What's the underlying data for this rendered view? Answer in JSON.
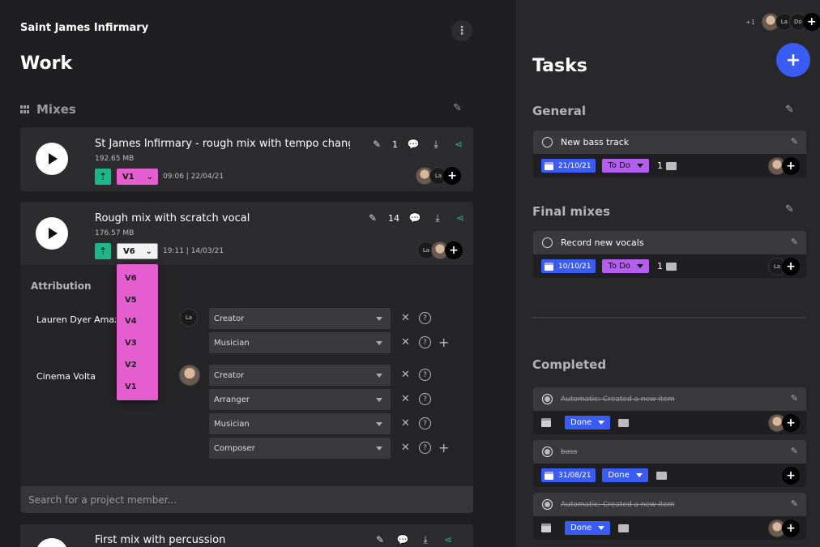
{
  "project": {
    "title": "Saint James Infirmary",
    "menu_icon": "kebab-icon"
  },
  "work": {
    "title": "Work"
  },
  "mixes": {
    "heading": "Mixes",
    "items": [
      {
        "title": "St James Infirmary - rough mix with tempo changes",
        "size": "192.65 MB",
        "version": "V1",
        "datetime": "09:06 | 22/04/21",
        "comment_count": "1"
      },
      {
        "title": "Rough mix with scratch vocal",
        "size": "176.57 MB",
        "version": "V6",
        "datetime": "19:11 | 14/03/21",
        "comment_count": "14"
      },
      {
        "title": "First mix with percussion"
      }
    ],
    "version_options": [
      "V6",
      "V5",
      "V4",
      "V3",
      "V2",
      "V1"
    ]
  },
  "attribution": {
    "heading": "Attribution",
    "people": [
      {
        "name": "Lauren Dyer Amazo",
        "avatar": "La",
        "roles": [
          "Creator",
          "Musician"
        ]
      },
      {
        "name": "Cinema Volta",
        "roles": [
          "Creator",
          "Arranger",
          "Musician",
          "Composer"
        ]
      }
    ],
    "search_placeholder": "Search for a project member..."
  },
  "tasks": {
    "title": "Tasks",
    "header_count": "+1",
    "header_avatars": [
      "La",
      "Do"
    ],
    "sections": [
      {
        "title": "General",
        "tasks": [
          {
            "name": "New bass track",
            "date": "21/10/21",
            "status": "To Do",
            "comments": "1"
          }
        ]
      },
      {
        "title": "Final mixes",
        "tasks": [
          {
            "name": "Record new vocals",
            "date": "10/10/21",
            "status": "To Do",
            "comments": "1",
            "avatar": "La"
          }
        ]
      }
    ],
    "completed": {
      "title": "Completed",
      "tasks": [
        {
          "name": "Automatic: Created a new item",
          "status": "Done"
        },
        {
          "name": "bass",
          "date": "31/08/21",
          "status": "Done"
        },
        {
          "name": "Automatic: Created a new item",
          "status": "Done"
        }
      ]
    }
  },
  "colors": {
    "accent_blue": "#3a5cf5",
    "pink": "#e55ed0",
    "green": "#1fb58a",
    "purple": "#b45ef0"
  }
}
